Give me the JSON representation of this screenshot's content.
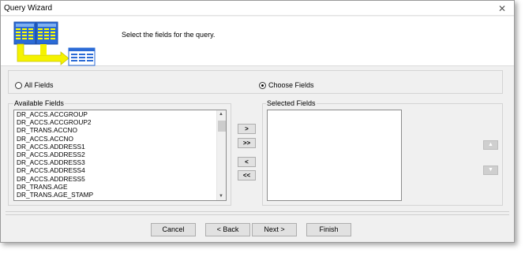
{
  "window": {
    "title": "Query Wizard"
  },
  "banner": {
    "instruction": "Select the fields for the query."
  },
  "selection_mode": {
    "all_fields": "All Fields",
    "choose_fields": "Choose Fields",
    "selected": "choose_fields"
  },
  "available_fields": {
    "label": "Available Fields",
    "items": [
      "DR_ACCS.ACCGROUP",
      "DR_ACCS.ACCGROUP2",
      "DR_TRANS.ACCNO",
      "DR_ACCS.ACCNO",
      "DR_ACCS.ADDRESS1",
      "DR_ACCS.ADDRESS2",
      "DR_ACCS.ADDRESS3",
      "DR_ACCS.ADDRESS4",
      "DR_ACCS.ADDRESS5",
      "DR_TRANS.AGE",
      "DR_TRANS.AGE_STAMP"
    ]
  },
  "move_buttons": {
    "add_one": ">",
    "add_all": ">>",
    "remove_one": "<",
    "remove_all": "<<"
  },
  "selected_fields": {
    "label": "Selected Fields",
    "items": []
  },
  "order_buttons": {
    "up_icon": "arrow-up-icon",
    "down_icon": "arrow-down-icon"
  },
  "footer": {
    "cancel": "Cancel",
    "back": "< Back",
    "next": "Next >",
    "finish": "Finish"
  },
  "colors": {
    "wizard_yellow": "#f5f200",
    "wizard_blue": "#2b6bd6",
    "window_bg": "#f0f0f0"
  }
}
